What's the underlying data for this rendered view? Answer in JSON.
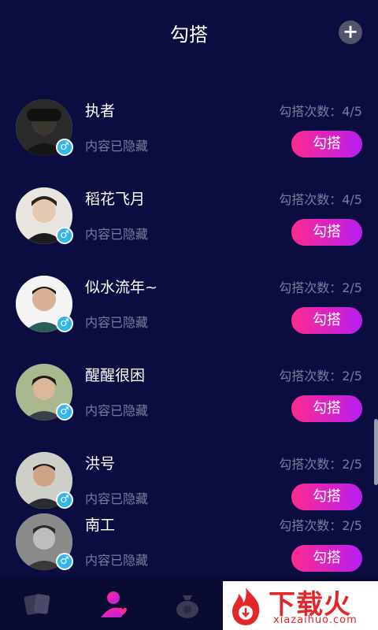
{
  "header": {
    "title": "勾搭",
    "add_label": "+"
  },
  "users": [
    {
      "name": "执者",
      "note": "内容已隐藏",
      "count": "勾搭次数：4/5",
      "button": "勾搭",
      "gender": "♂"
    },
    {
      "name": "稻花飞月",
      "note": "内容已隐藏",
      "count": "勾搭次数：4/5",
      "button": "勾搭",
      "gender": "♂"
    },
    {
      "name": "似水流年~",
      "note": "内容已隐藏",
      "count": "勾搭次数：2/5",
      "button": "勾搭",
      "gender": "♂"
    },
    {
      "name": "醒醒很困",
      "note": "内容已隐藏",
      "count": "勾搭次数：2/5",
      "button": "勾搭",
      "gender": "♂"
    },
    {
      "name": "洪号",
      "note": "内容已隐藏",
      "count": "勾搭次数：2/5",
      "button": "勾搭",
      "gender": "♂"
    },
    {
      "name": "南工",
      "note": "内容已隐藏",
      "count": "勾搭次数：2/5",
      "button": "勾搭",
      "gender": "♂"
    }
  ],
  "tabs": [
    {
      "icon": "cards-icon"
    },
    {
      "icon": "user-heart-icon",
      "active": true
    },
    {
      "icon": "money-bag-icon"
    }
  ],
  "watermark": {
    "text": "下载火",
    "url": "xiazaihuo.com"
  },
  "colors": {
    "background": "#0b0d40",
    "accent_start": "#ff2a8e",
    "accent_end": "#b61ef2",
    "gender_badge": "#2fb5ef"
  }
}
